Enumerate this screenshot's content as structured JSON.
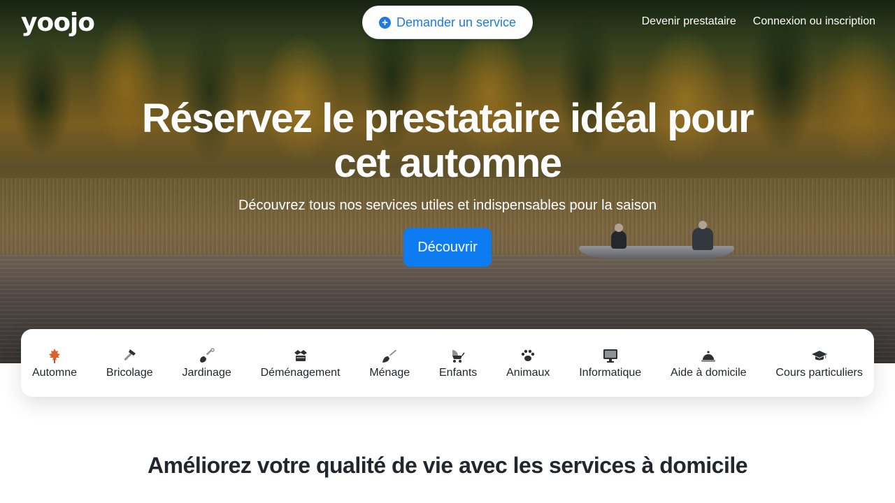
{
  "brand": {
    "logo_text": "yoojo"
  },
  "nav": {
    "request_service": "Demander un service",
    "become_provider": "Devenir prestataire",
    "login": "Connexion ou inscription"
  },
  "hero": {
    "title": "Réservez le prestataire idéal pour cet automne",
    "subtitle": "Découvrez tous nos services utiles et indispensables pour la saison",
    "cta": "Découvrir"
  },
  "categories": [
    {
      "label": "Automne",
      "icon": "maple-leaf-icon"
    },
    {
      "label": "Bricolage",
      "icon": "hammer-icon"
    },
    {
      "label": "Jardinage",
      "icon": "shovel-icon"
    },
    {
      "label": "Déménagement",
      "icon": "boxes-icon"
    },
    {
      "label": "Ménage",
      "icon": "broom-icon"
    },
    {
      "label": "Enfants",
      "icon": "stroller-icon"
    },
    {
      "label": "Animaux",
      "icon": "paw-icon"
    },
    {
      "label": "Informatique",
      "icon": "monitor-icon"
    },
    {
      "label": "Aide à domicile",
      "icon": "service-bell-icon"
    },
    {
      "label": "Cours particuliers",
      "icon": "graduation-cap-icon"
    }
  ],
  "section": {
    "title": "Améliorez votre qualité de vie avec les services à domicile"
  },
  "colors": {
    "primary": "#0d7cf2",
    "link_blue": "#1f7ae0",
    "text_dark": "#23262e"
  }
}
